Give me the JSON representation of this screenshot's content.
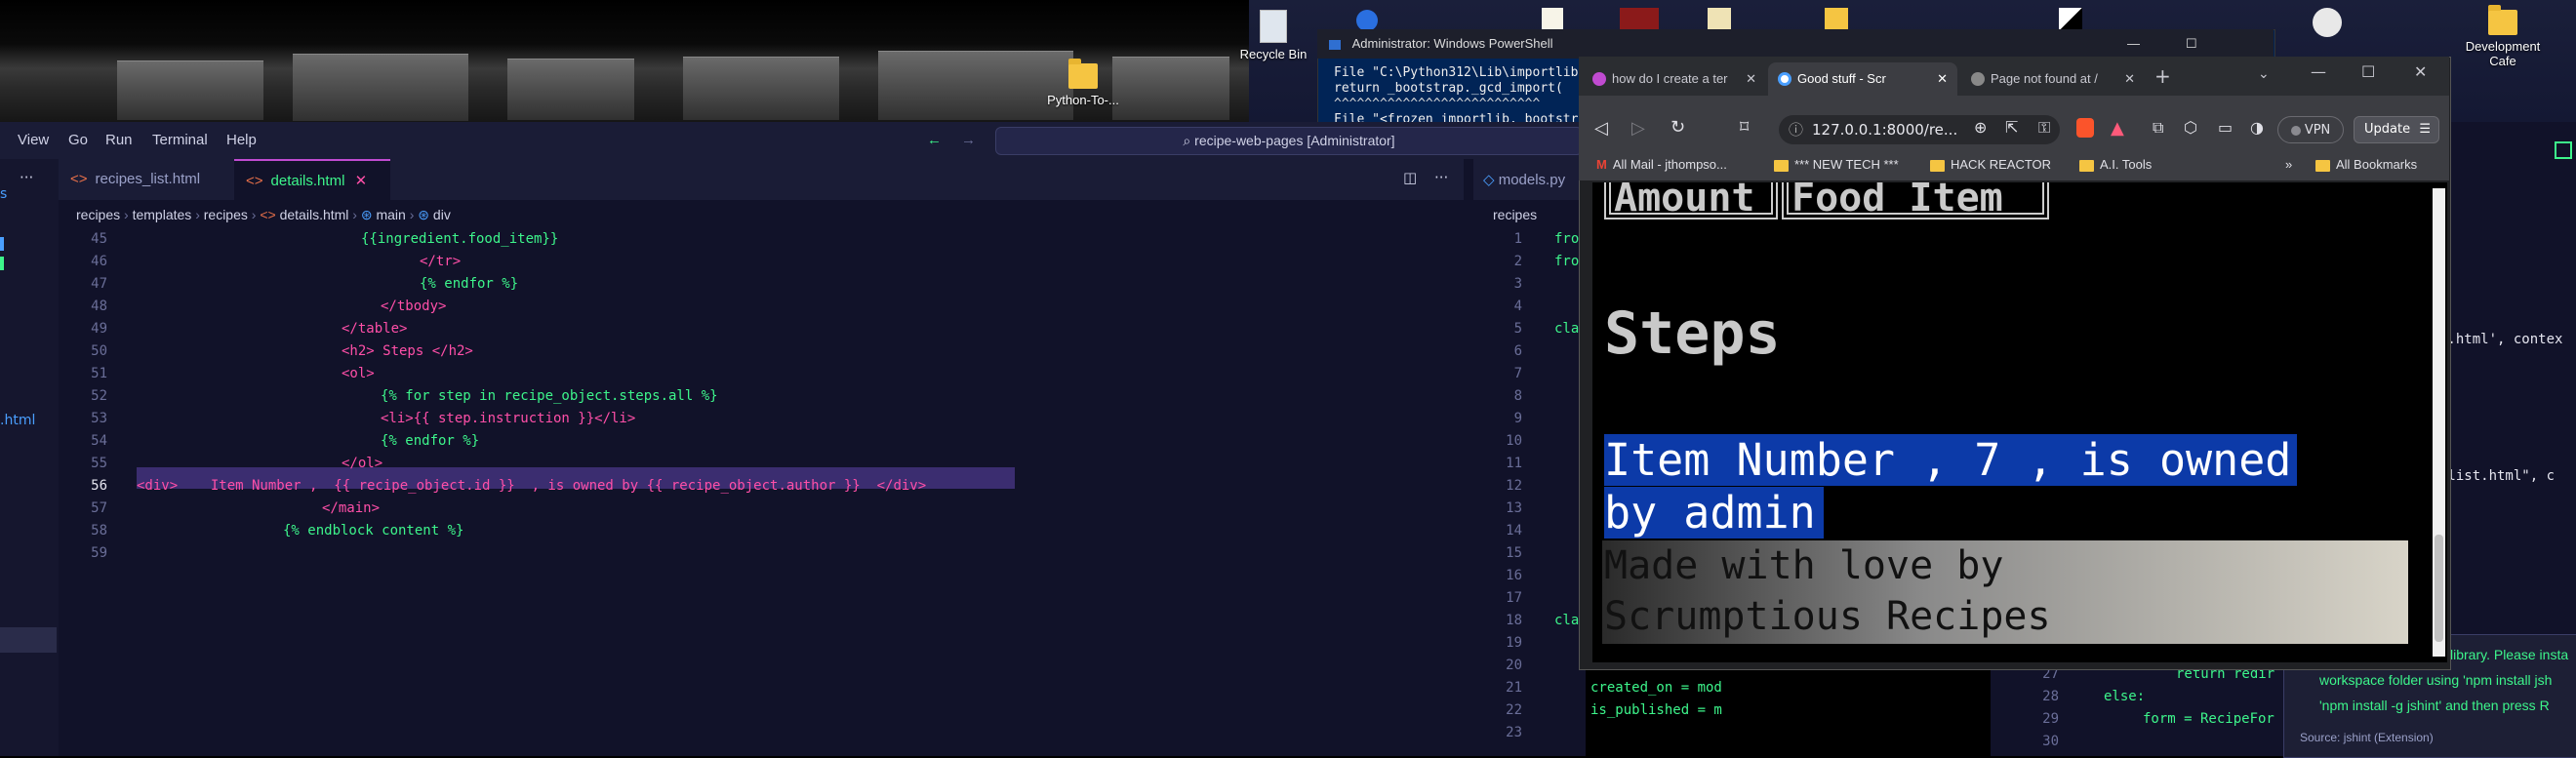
{
  "desktop": {
    "icons": [
      {
        "label": "Recycle Bin",
        "icon": "recycle-bin-icon"
      },
      {
        "label": "Python-To-...",
        "icon": "folder-icon"
      },
      {
        "label": "Development Cafe",
        "icon": "folder-icon"
      }
    ]
  },
  "powershell": {
    "title": "Administrator: Windows PowerShell",
    "lines": [
      "File \"C:\\Python312\\Lib\\importlib",
      "  return _bootstrap._gcd_import(",
      "         ^^^^^^^^^^^^^^^^^^^^^^^^^^^",
      "File \"<frozen importlib._bootstr"
    ]
  },
  "vscode": {
    "menu": [
      "View",
      "Go",
      "Run",
      "Terminal",
      "Help"
    ],
    "command_center": "recipe-web-pages [Administrator]",
    "tabs": [
      {
        "label": "recipes_list.html",
        "active": false
      },
      {
        "label": "details.html",
        "active": true
      }
    ],
    "breadcrumb": [
      "recipes",
      "templates",
      "recipes",
      "details.html",
      "main",
      "div"
    ],
    "right_tab": "models.py",
    "right_breadcrumb": "recipes",
    "editor_lines": [
      {
        "n": "45",
        "text": "{{ingredient.food_item}}"
      },
      {
        "n": "46",
        "text": "</tr>"
      },
      {
        "n": "47",
        "text": "{% endfor %}"
      },
      {
        "n": "48",
        "text": "</tbody>"
      },
      {
        "n": "49",
        "text": "</table>"
      },
      {
        "n": "50",
        "text": "<h2> Steps </h2>"
      },
      {
        "n": "51",
        "text": "<ol>"
      },
      {
        "n": "52",
        "text": "{% for step in recipe_object.steps.all %}"
      },
      {
        "n": "53",
        "text": "<li>{{ step.instruction }}</li>"
      },
      {
        "n": "54",
        "text": "{% endfor %}"
      },
      {
        "n": "55",
        "text": "</ol>"
      },
      {
        "n": "56",
        "text": "<div>    Item Number ,  {{ recipe_object.id }}  , is owned by {{ recipe_object.author }}  </div>"
      },
      {
        "n": "57",
        "text": "</main>"
      },
      {
        "n": "58",
        "text": "{% endblock content %}"
      },
      {
        "n": "59",
        "text": ""
      }
    ],
    "right_lines": [
      {
        "n": "1",
        "text": "fro"
      },
      {
        "n": "2",
        "text": "fro"
      },
      {
        "n": "3",
        "text": ""
      },
      {
        "n": "4",
        "text": ""
      },
      {
        "n": "5",
        "text": "cla"
      },
      {
        "n": "6",
        "text": ""
      },
      {
        "n": "7",
        "text": ""
      },
      {
        "n": "8",
        "text": ""
      },
      {
        "n": "9",
        "text": ""
      },
      {
        "n": "10",
        "text": ""
      },
      {
        "n": "11",
        "text": ""
      },
      {
        "n": "12",
        "text": ""
      },
      {
        "n": "13",
        "text": ""
      },
      {
        "n": "14",
        "text": ""
      },
      {
        "n": "15",
        "text": ""
      },
      {
        "n": "16",
        "text": ""
      },
      {
        "n": "17",
        "text": ""
      },
      {
        "n": "18",
        "text": "cla"
      },
      {
        "n": "19",
        "text": ""
      },
      {
        "n": "20",
        "text": ""
      },
      {
        "n": "21",
        "text": "created_on = mod"
      },
      {
        "n": "22",
        "text": "is_published = m"
      },
      {
        "n": "23",
        "text": ""
      }
    ],
    "far_right_lines": [
      {
        "n": "",
        "text": "s.html', contex"
      },
      {
        "n": "",
        "text": "_list.html\", c"
      },
      {
        "n": "27",
        "text": "return redir"
      },
      {
        "n": "28",
        "text": "else:"
      },
      {
        "n": "29",
        "text": "form = RecipeFor"
      },
      {
        "n": "30",
        "text": ""
      }
    ],
    "notification": {
      "line1": "library. Please insta",
      "line2": "workspace folder using 'npm install jsh",
      "line3": "'npm install -g jshint' and then press R",
      "source": "Source: jshint (Extension)"
    },
    "sidebar_fragment": ".html"
  },
  "browser": {
    "tabs": [
      {
        "label": "how do I create a ter",
        "active": false
      },
      {
        "label": "Good stuff - Scr",
        "active": true
      },
      {
        "label": "Page not found at /",
        "active": false
      }
    ],
    "url": "127.0.0.1:8000/re...",
    "vpn_label": "VPN",
    "update_label": "Update",
    "bookmarks": [
      "All Mail - jthompso...",
      "*** NEW TECH ***",
      "HACK REACTOR",
      "A.I. Tools"
    ],
    "all_bookmarks": "All Bookmarks",
    "page": {
      "table_headers": [
        "Amount",
        "Food Item"
      ],
      "steps_heading": "Steps",
      "owner_line1": "Item Number , 7 , is owned",
      "owner_line2": "by admin",
      "footer_line1": "Made with love by",
      "footer_line2": "Scrumptious Recipes"
    }
  },
  "colors": {
    "editor_bg": "#111229",
    "tag": "#ff4fa8",
    "template": "#3df58b",
    "selection": "#0c3aa8"
  }
}
